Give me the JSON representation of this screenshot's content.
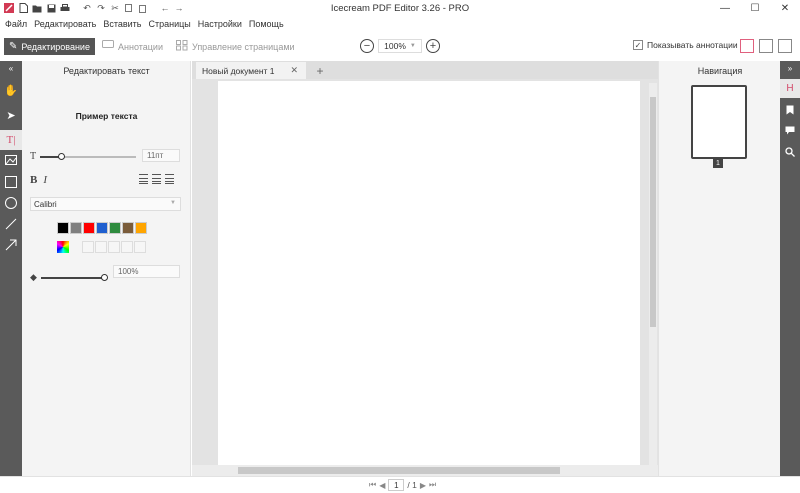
{
  "app": {
    "title": "Icecream PDF Editor 3.26 - PRO"
  },
  "window_controls": {
    "minimize": "—",
    "maximize": "☐",
    "close": "✕"
  },
  "menu": [
    "Файл",
    "Редактировать",
    "Вставить",
    "Страницы",
    "Настройки",
    "Помощь"
  ],
  "toolbar": {
    "modes": [
      {
        "label": "Редактирование",
        "icon": "pencil-icon",
        "active": true
      },
      {
        "label": "Аннотации",
        "icon": "speech-bubble-icon",
        "active": false
      },
      {
        "label": "Управление страницами",
        "icon": "pages-grid-icon",
        "active": false
      }
    ],
    "zoom_out": "−",
    "zoom_value": "100%",
    "zoom_in": "+",
    "show_annotations_label": "Показывать аннотации",
    "show_annotations_checked": true
  },
  "left_tools": [
    "collapse-icon",
    "hand-icon",
    "select-arrow-icon",
    "text-tool-icon",
    "image-icon",
    "rectangle-icon",
    "ellipse-icon",
    "line-icon",
    "arrow-icon"
  ],
  "text_panel": {
    "title": "Редактировать текст",
    "sample": "Пример текста",
    "font_size": "11пт",
    "bold": "B",
    "italic": "I",
    "font": "Calibri",
    "colors": [
      "#000000",
      "#7f7f7f",
      "#ff0000",
      "#1f5fcf",
      "#2e8b3e",
      "#7a5c3a",
      "#ffa500"
    ],
    "opacity": "100%"
  },
  "document": {
    "tab_title": "Новый документ 1",
    "tab_close": "✕",
    "tab_add": "+"
  },
  "navigation": {
    "title": "Навигация",
    "page_number": "1"
  },
  "right_tools": [
    "expand-icon",
    "pages-icon",
    "bookmark-icon",
    "comment-icon",
    "search-icon"
  ],
  "pager": {
    "current": "1",
    "total": "/ 1"
  }
}
